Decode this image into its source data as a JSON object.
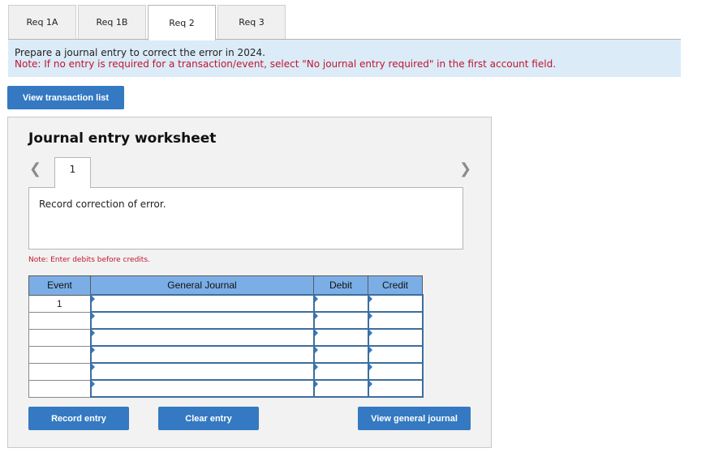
{
  "tabs": [
    {
      "label": "Req 1A",
      "active": false
    },
    {
      "label": "Req 1B",
      "active": false
    },
    {
      "label": "Req 2",
      "active": true
    },
    {
      "label": "Req 3",
      "active": false
    }
  ],
  "instructions": {
    "text": "Prepare a journal entry to correct the error in 2024.",
    "note": "Note: If no entry is required for a transaction/event, select \"No journal entry required\" in the first account field."
  },
  "view_transaction_list_label": "View transaction list",
  "worksheet": {
    "title": "Journal entry worksheet",
    "page_number": "1",
    "prev_icon": "chevron-left-icon",
    "next_icon": "chevron-right-icon",
    "description": "Record correction of error.",
    "debit_note": "Note: Enter debits before credits.",
    "table": {
      "headers": [
        "Event",
        "General Journal",
        "Debit",
        "Credit"
      ],
      "rows": [
        {
          "event": "1",
          "account": "",
          "debit": "",
          "credit": ""
        },
        {
          "event": "",
          "account": "",
          "debit": "",
          "credit": ""
        },
        {
          "event": "",
          "account": "",
          "debit": "",
          "credit": ""
        },
        {
          "event": "",
          "account": "",
          "debit": "",
          "credit": ""
        },
        {
          "event": "",
          "account": "",
          "debit": "",
          "credit": ""
        },
        {
          "event": "",
          "account": "",
          "debit": "",
          "credit": ""
        }
      ]
    },
    "buttons": {
      "record": "Record entry",
      "clear": "Clear entry",
      "view_general_journal": "View general journal"
    }
  },
  "colors": {
    "button_blue": "#3479c1",
    "header_blue": "#7baee6",
    "instruction_bg": "#dbebf8",
    "note_red": "#c0152f"
  }
}
